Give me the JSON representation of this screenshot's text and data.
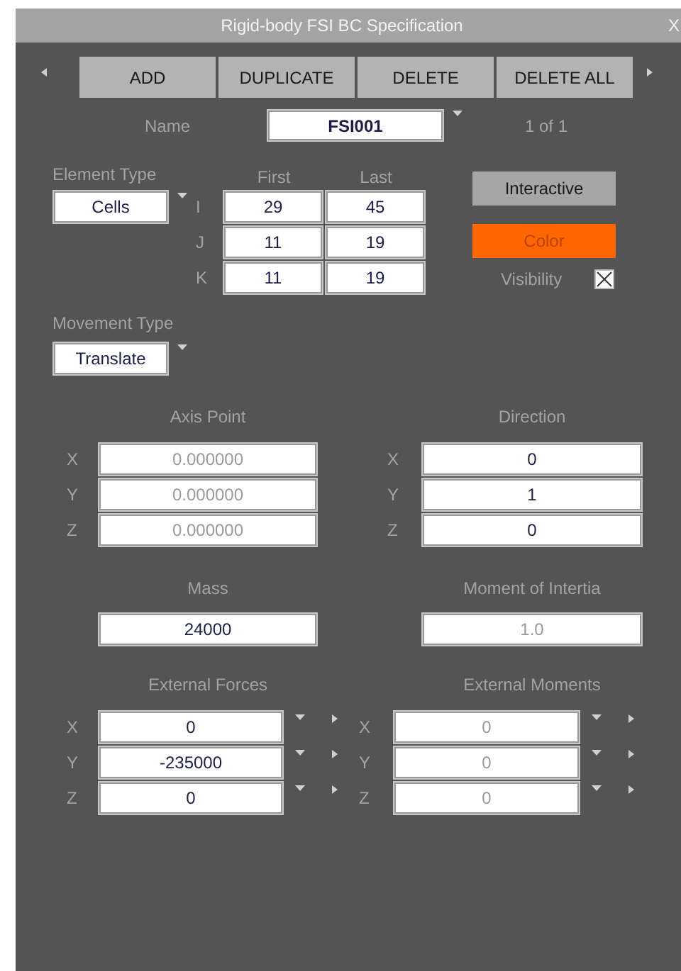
{
  "window": {
    "title": "Rigid-body FSI BC Specification",
    "close": "X"
  },
  "toolbar": {
    "buttons": [
      "ADD",
      "DUPLICATE",
      "DELETE",
      "DELETE ALL"
    ]
  },
  "name": {
    "label": "Name",
    "value": "FSI001",
    "counter": "1 of 1"
  },
  "element_type": {
    "label": "Element Type",
    "value": "Cells"
  },
  "ranges": {
    "columns": [
      "First",
      "Last"
    ],
    "rows": [
      {
        "label": "I",
        "first": "29",
        "last": "45"
      },
      {
        "label": "J",
        "first": "11",
        "last": "19"
      },
      {
        "label": "K",
        "first": "11",
        "last": "19"
      }
    ]
  },
  "interactive_button": "Interactive",
  "color_button": {
    "label": "Color",
    "color": "#ff6600"
  },
  "visibility": {
    "label": "Visibility",
    "checked": true
  },
  "movement_type": {
    "label": "Movement Type",
    "value": "Translate"
  },
  "axis_point": {
    "title": "Axis Point",
    "rows": [
      {
        "label": "X",
        "value": "0.000000",
        "disabled": true
      },
      {
        "label": "Y",
        "value": "0.000000",
        "disabled": true
      },
      {
        "label": "Z",
        "value": "0.000000",
        "disabled": true
      }
    ]
  },
  "direction": {
    "title": "Direction",
    "rows": [
      {
        "label": "X",
        "value": "0",
        "disabled": false
      },
      {
        "label": "Y",
        "value": "1",
        "disabled": false
      },
      {
        "label": "Z",
        "value": "0",
        "disabled": false
      }
    ]
  },
  "mass": {
    "title": "Mass",
    "value": "24000",
    "disabled": false
  },
  "moment_of_inertia": {
    "title": "Moment of Intertia",
    "value": "1.0",
    "disabled": true
  },
  "external_forces": {
    "title": "External Forces",
    "rows": [
      {
        "label": "X",
        "value": "0",
        "disabled": false
      },
      {
        "label": "Y",
        "value": "-235000",
        "disabled": false
      },
      {
        "label": "Z",
        "value": "0",
        "disabled": false
      }
    ]
  },
  "external_moments": {
    "title": "External Moments",
    "rows": [
      {
        "label": "X",
        "value": "0",
        "disabled": true
      },
      {
        "label": "Y",
        "value": "0",
        "disabled": true
      },
      {
        "label": "Z",
        "value": "0",
        "disabled": true
      }
    ]
  }
}
